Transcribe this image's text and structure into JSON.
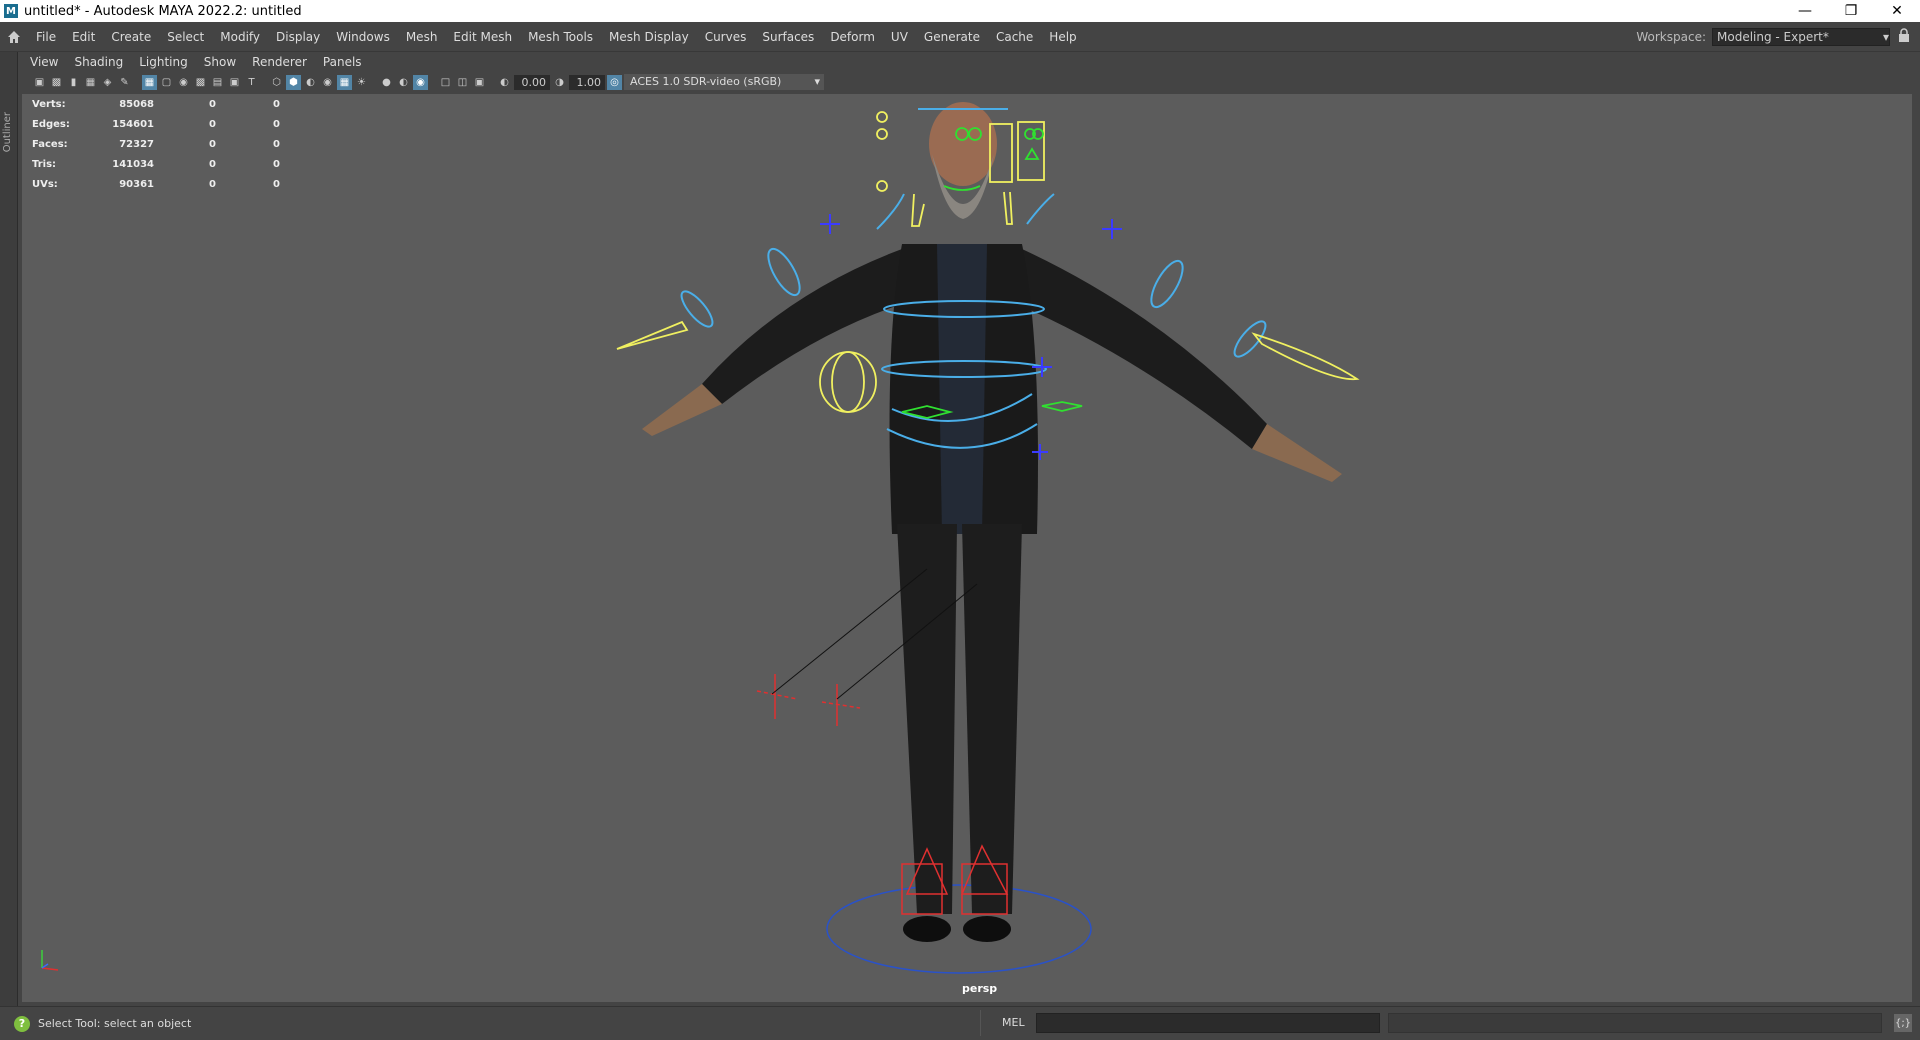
{
  "window": {
    "title": "untitled* - Autodesk MAYA 2022.2: untitled",
    "app_icon": "M"
  },
  "menu": [
    "File",
    "Edit",
    "Create",
    "Select",
    "Modify",
    "Display",
    "Windows",
    "Mesh",
    "Edit Mesh",
    "Mesh Tools",
    "Mesh Display",
    "Curves",
    "Surfaces",
    "Deform",
    "UV",
    "Generate",
    "Cache",
    "Help"
  ],
  "workspace": {
    "label": "Workspace:",
    "value": "Modeling - Expert*"
  },
  "outliner": {
    "label": "Outliner"
  },
  "panel_menu": [
    "View",
    "Shading",
    "Lighting",
    "Show",
    "Renderer",
    "Panels"
  ],
  "toolbar": {
    "exposure": "0.00",
    "gamma": "1.00",
    "color_space": "ACES 1.0 SDR-video (sRGB)"
  },
  "hud": [
    {
      "k": "Verts:",
      "v": "85068",
      "a": "0",
      "b": "0"
    },
    {
      "k": "Edges:",
      "v": "154601",
      "a": "0",
      "b": "0"
    },
    {
      "k": "Faces:",
      "v": "72327",
      "a": "0",
      "b": "0"
    },
    {
      "k": "Tris:",
      "v": "141034",
      "a": "0",
      "b": "0"
    },
    {
      "k": "UVs:",
      "v": "90361",
      "a": "0",
      "b": "0"
    }
  ],
  "viewport": {
    "camera": "persp"
  },
  "status": {
    "help_text": "Select Tool: select an object",
    "mel_label": "MEL"
  },
  "colors": {
    "bg": "#5c5c5c",
    "control_blue": "#4aaee8",
    "control_yellow": "#f0f060",
    "control_red": "#e03030",
    "control_green": "#30e030"
  }
}
